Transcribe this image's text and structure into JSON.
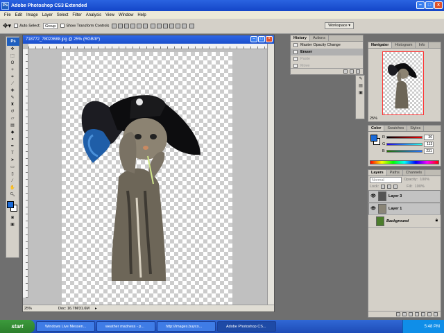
{
  "app": {
    "title": "Adobe Photoshop CS3 Extended",
    "logo": "Ps"
  },
  "menubar": [
    "File",
    "Edit",
    "Image",
    "Layer",
    "Select",
    "Filter",
    "Analysis",
    "View",
    "Window",
    "Help"
  ],
  "options": {
    "auto_select": "Auto-Select:",
    "auto_select_value": "Group",
    "show_transform": "Show Transform Controls",
    "workspace": "Workspace"
  },
  "document": {
    "title": "718772_78023688.jpg @ 25% (RGB/8*)",
    "zoom": "25%",
    "doc_info": "Doc: 16.7M/31.6M"
  },
  "history": {
    "tabs": [
      "History",
      "Actions"
    ],
    "items": [
      {
        "label": "Master Opacity Change",
        "state": "normal"
      },
      {
        "label": "Eraser",
        "state": "active"
      },
      {
        "label": "Paste",
        "state": "dim"
      },
      {
        "label": "Move",
        "state": "dim"
      }
    ]
  },
  "navigator": {
    "tabs": [
      "Navigator",
      "Histogram",
      "Info"
    ],
    "zoom": "25%"
  },
  "color": {
    "tabs": [
      "Color",
      "Swatches",
      "Styles"
    ],
    "r": "36",
    "g": "113",
    "b": "231",
    "fg_color": "#2471e7"
  },
  "layers": {
    "tabs": [
      "Layers",
      "Paths",
      "Channels"
    ],
    "blend_mode": "Normal",
    "opacity_label": "Opacity:",
    "opacity": "100%",
    "lock_label": "Lock:",
    "fill_label": "Fill:",
    "fill": "100%",
    "items": [
      {
        "name": "Layer 3",
        "selected": true
      },
      {
        "name": "Layer 1",
        "selected": true
      },
      {
        "name": "Background",
        "selected": false
      }
    ]
  },
  "taskbar": {
    "start": "start",
    "tasks": [
      "Windows Live Messen...",
      "weather madness - p...",
      "http://images.buyco...",
      "Adobe Photoshop CS..."
    ],
    "time": "5:48 PM"
  }
}
